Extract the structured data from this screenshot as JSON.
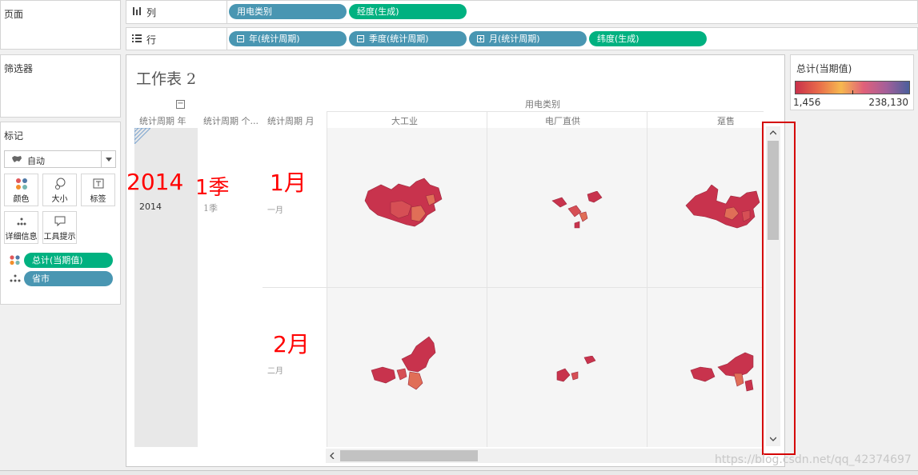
{
  "left_panels": {
    "pages_title": "页面",
    "filters_title": "筛选器",
    "marks": {
      "title": "标记",
      "mark_type": "自动",
      "buttons": [
        "颜色",
        "大小",
        "标签",
        "详细信息",
        "工具提示"
      ],
      "fields": [
        {
          "label": "总计(当期值)",
          "color": "#00b180",
          "icon": "color-dots-icon"
        },
        {
          "label": "省市",
          "color": "#4996b2",
          "icon": "detail-dots-icon"
        }
      ]
    }
  },
  "shelves": {
    "columns": {
      "label": "列",
      "pills": [
        {
          "label": "用电类别",
          "color": "#4996b2"
        },
        {
          "label": "经度(生成)",
          "color": "#00b180"
        }
      ]
    },
    "rows": {
      "label": "行",
      "pills": [
        {
          "label": "年(统计周期)",
          "color": "#4996b2",
          "prefix": "minus"
        },
        {
          "label": "季度(统计周期)",
          "color": "#4996b2",
          "prefix": "minus"
        },
        {
          "label": "月(统计周期)",
          "color": "#4996b2",
          "prefix": "plus"
        },
        {
          "label": "纬度(生成)",
          "color": "#00b180"
        }
      ]
    }
  },
  "sheet": {
    "title": "工作表 2",
    "collapse_symbol": "−",
    "column_group_header": "用电类别",
    "row_headers": [
      "统计周期 年",
      "统计周期 个...",
      "统计周期 月"
    ],
    "column_headers": [
      "大工业",
      "电厂直供",
      "趸售"
    ],
    "year": "2014",
    "quarter": "1季",
    "months": [
      "一月",
      "二月"
    ]
  },
  "annotations": {
    "year": "2014",
    "quarter": "1季",
    "month1": "1月",
    "month2": "2月",
    "color": "#ff0000"
  },
  "legend": {
    "title": "总计(当期值)",
    "min": "1,456",
    "max": "238,130",
    "gradient": [
      "#c9314b",
      "#e86a4a",
      "#f6b84f",
      "#e0607a",
      "#a45f9a",
      "#4a5f9c"
    ]
  },
  "watermark": "https://blog.csdn.net/qq_42374697",
  "colors": {
    "map_dark": "#c8334d",
    "map_mid": "#d64f55",
    "map_light": "#e06e57"
  }
}
